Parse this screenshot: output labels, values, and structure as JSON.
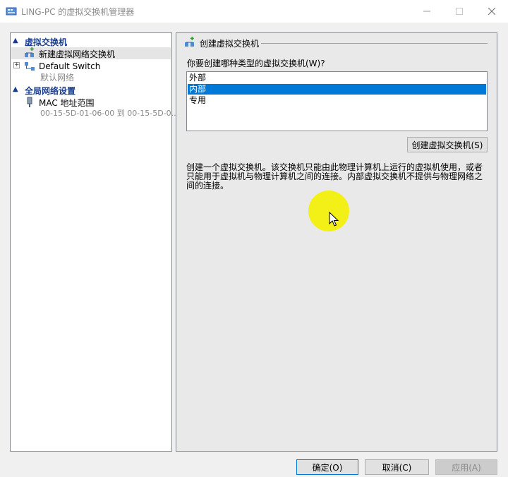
{
  "window": {
    "title": "LING-PC 的虚拟交换机管理器",
    "icons": {
      "app": "vswitch-manager-icon",
      "minimize": "minimize-icon",
      "maximize": "maximize-icon",
      "close": "close-icon"
    }
  },
  "sidebar": {
    "section_virtual_switches": "虚拟交换机",
    "new_switch_item": "新建虚拟网络交换机",
    "default_switch": {
      "name": "Default Switch",
      "subtitle": "默认网络"
    },
    "section_global": "全局网络设置",
    "mac_range": {
      "name": "MAC 地址范围",
      "subtitle": "00-15-5D-01-06-00 到 00-15-5D-0..."
    }
  },
  "main": {
    "section_title": "创建虚拟交换机",
    "question": "你要创建哪种类型的虚拟交换机(W)?",
    "switch_types": [
      "外部",
      "内部",
      "专用"
    ],
    "selected_type": "内部",
    "create_button": "创建虚拟交换机(S)",
    "description": "创建一个虚拟交换机。该交换机只能由此物理计算机上运行的虚拟机使用，或者只能用于虚拟机与物理计算机之间的连接。内部虚拟交换机不提供与物理网络之间的连接。"
  },
  "footer": {
    "ok": "确定(O)",
    "cancel": "取消(C)",
    "apply": "应用(A)"
  },
  "colors": {
    "selection": "#0078d7",
    "section_header": "#1a3c8c",
    "cursor_highlight": "#f3f018"
  }
}
